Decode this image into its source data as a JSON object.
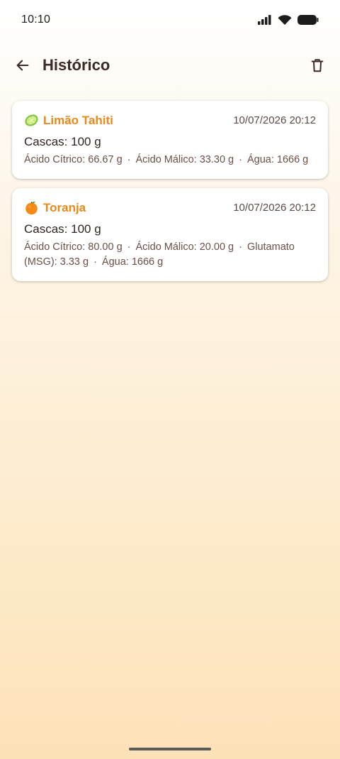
{
  "status": {
    "time": "10:10"
  },
  "app_bar": {
    "title": "Histórico",
    "back_icon": "arrow-left-icon",
    "delete_icon": "trash-icon"
  },
  "entries": [
    {
      "fruit_icon": "lime-icon",
      "name": "Limão Tahiti",
      "date": "10/07/2026 20:12",
      "peels": "Cascas: 100 g",
      "details": [
        "Ácido Cítrico: 66.67 g",
        "Ácido Málico: 33.30 g",
        "Água: 1666 g"
      ]
    },
    {
      "fruit_icon": "orange-icon",
      "name": "Toranja",
      "date": "10/07/2026 20:12",
      "peels": "Cascas: 100 g",
      "details": [
        "Ácido Cítrico: 80.00 g",
        "Ácido Málico: 20.00 g",
        "Glutamato (MSG): 3.33 g",
        "Água: 1666 g"
      ]
    }
  ],
  "colors": {
    "accent": "#e8891a",
    "text": "#3b2a26"
  }
}
